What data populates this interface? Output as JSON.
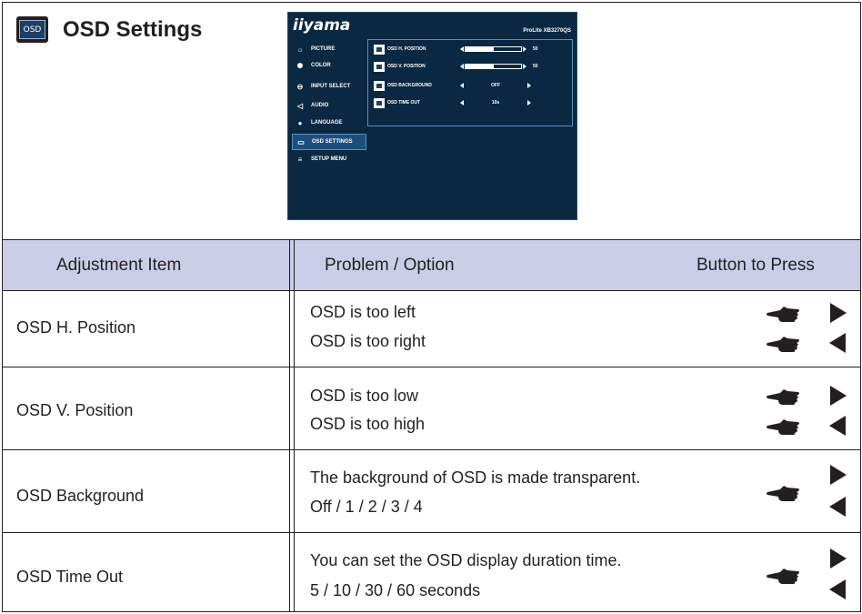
{
  "section": {
    "title": "OSD Settings",
    "badge_label": "OSD"
  },
  "osd_screen": {
    "brand": "iiyama",
    "model": "ProLite XB3270QS",
    "menu": [
      {
        "label": "PICTURE",
        "icon": "picture-icon",
        "selected": false
      },
      {
        "label": "COLOR",
        "icon": "color-icon",
        "selected": false
      },
      {
        "label": "INPUT SELECT",
        "icon": "input-select-icon",
        "selected": false
      },
      {
        "label": "AUDIO",
        "icon": "audio-icon",
        "selected": false
      },
      {
        "label": "LANGUAGE",
        "icon": "globe-icon",
        "selected": false
      },
      {
        "label": "OSD SETTINGS",
        "icon": "osd-icon",
        "selected": true
      },
      {
        "label": "SETUP MENU",
        "icon": "setup-icon",
        "selected": false
      }
    ],
    "submenu": [
      {
        "label": "OSD H. POSITION",
        "kind": "bar",
        "value": "50",
        "level": 0.5
      },
      {
        "label": "OSD V. POSITION",
        "kind": "bar",
        "value": "50",
        "level": 0.5
      },
      {
        "label": "OSD BACKGROUND",
        "kind": "option",
        "value": "OFF"
      },
      {
        "label": "OSD TIME OUT",
        "kind": "option",
        "value": "10s"
      }
    ]
  },
  "table": {
    "headers": {
      "item": "Adjustment Item",
      "problem": "Problem / Option",
      "button": "Button to Press"
    },
    "rows": [
      {
        "item": "OSD H. Position",
        "lines": [
          "OSD is too left",
          "OSD is too right"
        ],
        "buttons": [
          "right-arrow",
          "left-arrow"
        ]
      },
      {
        "item": "OSD V. Position",
        "lines": [
          "OSD is too low",
          "OSD is too high"
        ],
        "buttons": [
          "right-arrow",
          "left-arrow"
        ]
      },
      {
        "item": "OSD Background",
        "lines": [
          "The background of OSD is made transparent.",
          "Off / 1 / 2 / 3 / 4"
        ],
        "buttons": [
          "right-arrow",
          "left-arrow"
        ]
      },
      {
        "item": "OSD Time Out",
        "lines": [
          "You can set the OSD display duration time.",
          "5 / 10 / 30 / 60 seconds"
        ],
        "buttons": [
          "right-arrow",
          "left-arrow"
        ]
      }
    ]
  },
  "colors": {
    "header_bg": "#c7cee6",
    "osd_bg": "#0a2842",
    "text": "#231f20"
  }
}
